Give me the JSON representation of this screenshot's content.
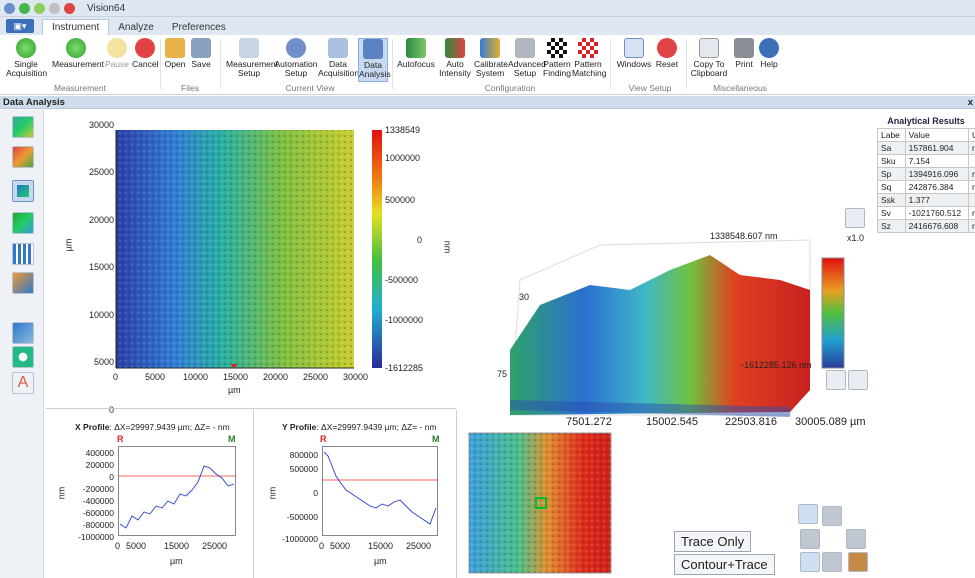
{
  "window": {
    "title": "Vision64"
  },
  "tabs": [
    {
      "label": "Instrument",
      "active": true
    },
    {
      "label": "Analyze",
      "active": false
    },
    {
      "label": "Preferences",
      "active": false
    }
  ],
  "ribbon": {
    "measurement": {
      "group_label": "Measurement",
      "single_acq": "Single\nAcquisition",
      "measurement": "Measurement",
      "pause": "Pause",
      "cancel": "Cancel"
    },
    "files": {
      "group_label": "Files",
      "open": "Open",
      "save": "Save"
    },
    "view": {
      "group_label": "Current View",
      "meas_setup": "Measurement\nSetup",
      "auto_setup": "Automation\nSetup",
      "data_acq": "Data\nAcquisition",
      "data_analysis": "Data\nAnalysis"
    },
    "config": {
      "group_label": "Configuration",
      "autofocus": "Autofocus",
      "auto_intensity": "Auto\nIntensity",
      "calibrate": "Calibrate\nSystem",
      "adv_setup": "Advanced\nSetup",
      "pattern_finding": "Pattern\nFinding",
      "pattern_matching": "Pattern\nMatching"
    },
    "viewsetup": {
      "group_label": "View Setup",
      "windows": "Windows",
      "reset": "Reset"
    },
    "misc": {
      "group_label": "Miscellaneous",
      "copy": "Copy To\nClipboard",
      "print": "Print",
      "help": "Help"
    }
  },
  "panel": {
    "title": "Data Analysis",
    "close": "x"
  },
  "heatmap": {
    "y_ticks": [
      "30000",
      "25000",
      "20000",
      "15000",
      "10000",
      "5000",
      "0"
    ],
    "x_ticks": [
      "0",
      "5000",
      "10000",
      "15000",
      "20000",
      "25000",
      "30000"
    ],
    "ylabel": "µm",
    "xlabel": "µm",
    "cbar_ticks": [
      "1338549",
      "1000000",
      "500000",
      "0",
      "-500000",
      "-1000000",
      "-1612285"
    ],
    "cbar_label": "nm"
  },
  "xprofile": {
    "title_prefix": "X Profile",
    "title_rest": ": ΔX=29997.9439 µm; ΔZ= -  nm",
    "r": "R",
    "m": "M",
    "y_ticks": [
      "400000",
      "200000",
      "0",
      "-200000",
      "-400000",
      "-600000",
      "-800000",
      "-1000000"
    ],
    "x_ticks": [
      "0",
      "5000",
      "15000",
      "25000"
    ],
    "ylabel": "nm",
    "xlabel": "µm"
  },
  "yprofile": {
    "title_prefix": "Y Profile",
    "title_rest": ": ΔX=29997.9439 µm; ΔZ= -  nm",
    "r": "R",
    "m": "M",
    "y_ticks": [
      "800000",
      "500000",
      "0",
      "-500000",
      "-1000000"
    ],
    "x_ticks": [
      "0",
      "5000",
      "15000",
      "25000"
    ],
    "ylabel": "nm",
    "xlabel": "µm"
  },
  "surface3d": {
    "max_label": "1338548.607 nm",
    "min_label": "-1612285.126 nm",
    "scale": "x1.0",
    "x_ticks": [
      "7501.272",
      "15002.545",
      "22503.816",
      "30005.089 µm"
    ],
    "y_tick_top": "30",
    "y_tick_low": "75"
  },
  "results": {
    "title": "Analytical Results",
    "headers": [
      "Labe",
      "Value",
      "Un"
    ],
    "rows": [
      [
        "Sa",
        "157861.904",
        "nm"
      ],
      [
        "Sku",
        "7.154",
        ""
      ],
      [
        "Sp",
        "1394916.096",
        "nm"
      ],
      [
        "Sq",
        "242876.384",
        "nm"
      ],
      [
        "Ssk",
        "1.377",
        ""
      ],
      [
        "Sv",
        "-1021760.512",
        "nm"
      ],
      [
        "Sz",
        "2416676.608",
        "nm"
      ]
    ]
  },
  "buttons": {
    "trace_only": "Trace Only",
    "contour_trace": "Contour+Trace"
  }
}
